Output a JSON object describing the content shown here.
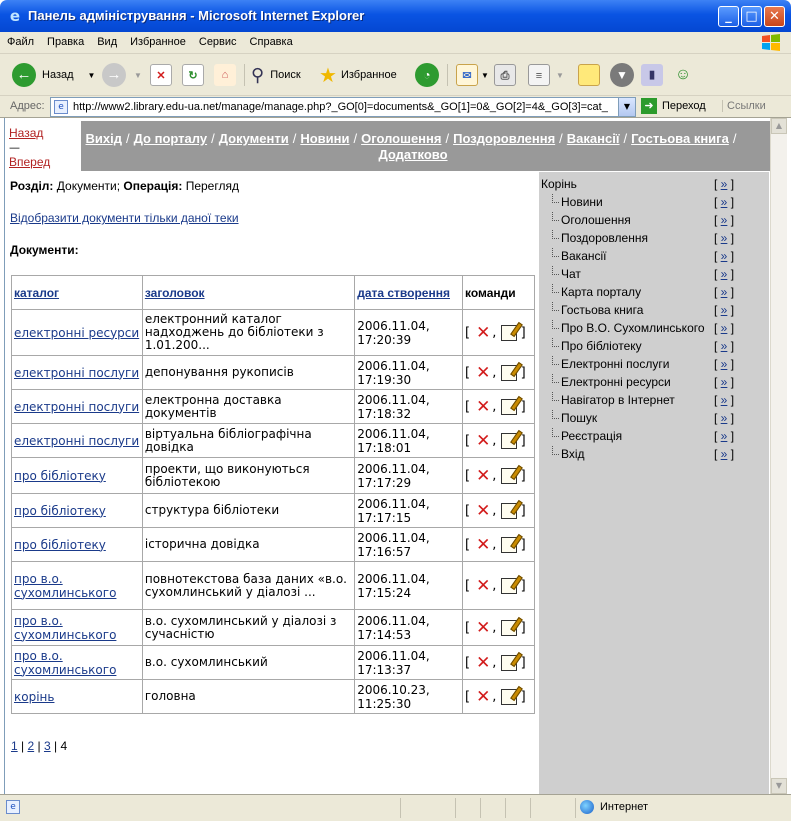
{
  "window": {
    "title": "Панель адміністрування - Microsoft Internet Explorer",
    "minimize": "_",
    "maximize": "□",
    "close": "✕"
  },
  "menu": [
    "Файл",
    "Правка",
    "Вид",
    "Избранное",
    "Сервис",
    "Справка"
  ],
  "toolbar": {
    "back_label": "Назад",
    "search_label": "Поиск",
    "favorites_label": "Избранное"
  },
  "address": {
    "label": "Адрес:",
    "url": "http://www2.library.edu-ua.net/manage/manage.php?_GO[0]=documents&_GO[1]=0&_GO[2]=4&_GO[3]=cat_",
    "go_label": "Переход",
    "links_label": "Ссылки"
  },
  "nav": {
    "back": "Назад",
    "dash": "—",
    "forward": "Вперед",
    "links": [
      "Вихід",
      "До порталу",
      "Документи",
      "Новини",
      "Оголошення",
      "Поздоровлення",
      "Вакансії",
      "Гостьова книга",
      "Додатково"
    ]
  },
  "info": {
    "section_label": "Розділ:",
    "section_value": "Документи;",
    "operation_label": "Операція:",
    "operation_value": "Перегляд"
  },
  "show_link": "Відобразити документи тільки даної теки",
  "documents_title": "Документи:",
  "table": {
    "headers": {
      "catalog": "каталог",
      "title": "заголовок",
      "date": "дата створення",
      "commands": "команди"
    },
    "rows": [
      {
        "catalog": "електронні ресурси",
        "title": "електронний каталог надходжень до бібліотеки з 1.01.200...",
        "date": "2006.11.04, 17:20:39"
      },
      {
        "catalog": "електронні послуги",
        "title": "депонування рукописів",
        "date": "2006.11.04, 17:19:30"
      },
      {
        "catalog": "електронні послуги",
        "title": "електронна доставка документів",
        "date": "2006.11.04, 17:18:32"
      },
      {
        "catalog": "електронні послуги",
        "title": "віртуальна бібліографічна довідка",
        "date": "2006.11.04, 17:18:01"
      },
      {
        "catalog": "про бібліотеку",
        "title": "проекти, що виконуються бібліотекою",
        "date": "2006.11.04, 17:17:29"
      },
      {
        "catalog": "про бібліотеку",
        "title": "структура бібліотеки",
        "date": "2006.11.04, 17:17:15"
      },
      {
        "catalog": "про бібліотеку",
        "title": "історична довідка",
        "date": "2006.11.04, 17:16:57"
      },
      {
        "catalog": "про в.о. сухомлинського",
        "title": "повнотекстова база даних «в.о. сухомлинський у діалозі ...",
        "date": "2006.11.04, 17:15:24"
      },
      {
        "catalog": "про в.о. сухомлинського",
        "title": "в.о. сухомлинський у діалозі з сучасністю",
        "date": "2006.11.04, 17:14:53"
      },
      {
        "catalog": "про в.о. сухомлинського",
        "title": "в.о. сухомлинський",
        "date": "2006.11.04, 17:13:37"
      },
      {
        "catalog": "корінь",
        "title": "головна",
        "date": "2006.10.23, 11:25:30"
      }
    ]
  },
  "pager": [
    "1",
    "2",
    "3",
    "4"
  ],
  "tree": {
    "action": "»",
    "root": "Корінь",
    "items": [
      "Новини",
      "Оголошення",
      "Поздоровлення",
      "Вакансії",
      "Чат",
      "Карта порталу",
      "Гостьова книга",
      "Про В.О. Сухомлинського",
      "Про бібліотеку",
      "Електронні послуги",
      "Електронні ресурси",
      "Навігатор в Інтернет",
      "Пошук",
      "Реєстрація",
      "Вхід"
    ]
  },
  "status": {
    "zone": "Интернет"
  }
}
